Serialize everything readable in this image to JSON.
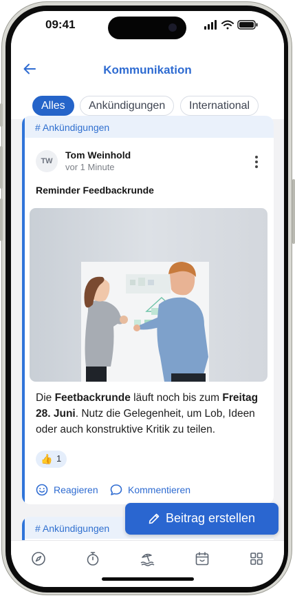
{
  "status": {
    "time": "09:41"
  },
  "header": {
    "title": "Kommunikation",
    "back_icon": "arrow-left-icon"
  },
  "filters": [
    {
      "label": "Alles",
      "active": true
    },
    {
      "label": "Ankündigungen",
      "active": false
    },
    {
      "label": "International",
      "active": false
    }
  ],
  "post": {
    "channel": "# Ankündigungen",
    "author_initials": "TW",
    "author": "Tom Weinhold",
    "time_ago": "vor 1 Minute",
    "title": "Reminder Feedbackrunde",
    "body": {
      "p1": "Die ",
      "b1": "Feetbackrunde",
      "p2": " läuft noch bis zum ",
      "b2": "Freitag 28. Juni",
      "p3": ". Nutz die Gelegenheit, um Lob, Ideen oder auch konstruktive Kritik zu teilen."
    },
    "reaction": {
      "emoji": "👍",
      "count": "1"
    },
    "actions": {
      "react": "Reagieren",
      "comment": "Kommentieren"
    }
  },
  "next_post": {
    "channel": "# Ankündigungen"
  },
  "cta": {
    "label": "Beitrag erstellen"
  },
  "tabs": [
    "compass-icon",
    "stopwatch-icon",
    "beach-icon",
    "calendar-icon",
    "grid-icon"
  ],
  "colors": {
    "accent": "#2564c9",
    "accent_light": "#eaf1fb"
  }
}
